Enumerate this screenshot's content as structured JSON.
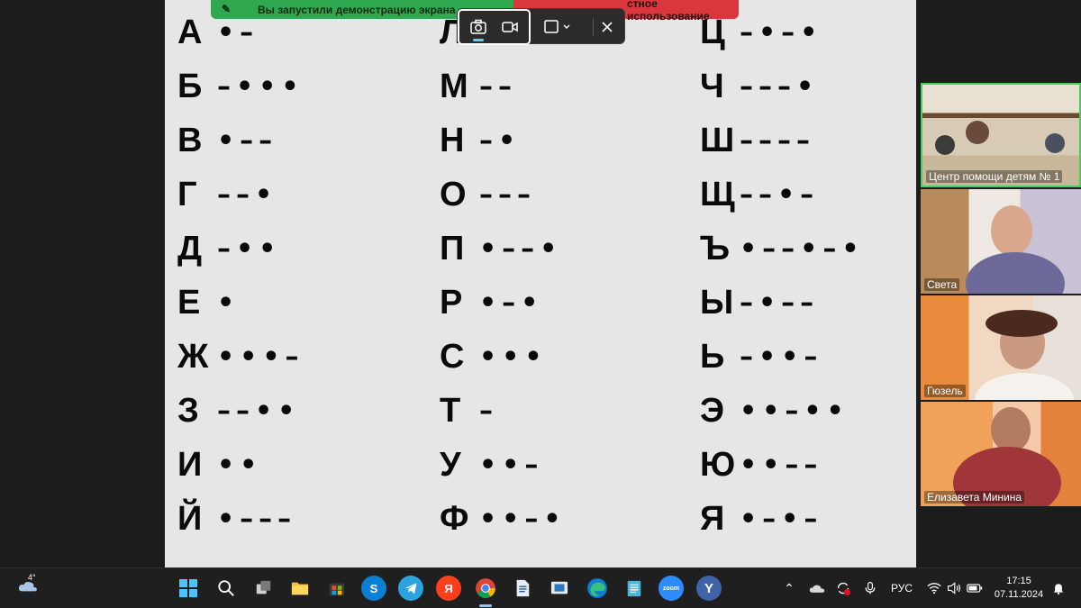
{
  "screen_share": {
    "green_banner_text": "Вы запустили демонстрацию экрана",
    "red_banner_text": "стное использование"
  },
  "morse": {
    "columns": [
      [
        {
          "letter": "А",
          "code": "•–"
        },
        {
          "letter": "Б",
          "code": "–•••"
        },
        {
          "letter": "В",
          "code": "•––"
        },
        {
          "letter": "Г",
          "code": "––•"
        },
        {
          "letter": "Д",
          "code": "–••"
        },
        {
          "letter": "Е",
          "code": "•"
        },
        {
          "letter": "Ж",
          "code": "•••–"
        },
        {
          "letter": "З",
          "code": "––••"
        },
        {
          "letter": "И",
          "code": "••"
        },
        {
          "letter": "Й",
          "code": "•–––"
        }
      ],
      [
        {
          "letter": "Л",
          "code": ""
        },
        {
          "letter": "М",
          "code": "––"
        },
        {
          "letter": "Н",
          "code": "–•"
        },
        {
          "letter": "О",
          "code": "–––"
        },
        {
          "letter": "П",
          "code": "•––•"
        },
        {
          "letter": "Р",
          "code": "•–•"
        },
        {
          "letter": "С",
          "code": "•••"
        },
        {
          "letter": "Т",
          "code": "–"
        },
        {
          "letter": "У",
          "code": "••–"
        },
        {
          "letter": "Ф",
          "code": "••–•"
        }
      ],
      [
        {
          "letter": "Ц",
          "code": "–•–•"
        },
        {
          "letter": "Ч",
          "code": "–––•"
        },
        {
          "letter": "Ш",
          "code": "––––"
        },
        {
          "letter": "Щ",
          "code": "––•–"
        },
        {
          "letter": "Ъ",
          "code": "•––•–•"
        },
        {
          "letter": "Ы",
          "code": "–•––"
        },
        {
          "letter": "Ь",
          "code": "–••–"
        },
        {
          "letter": "Э",
          "code": "••–••"
        },
        {
          "letter": "Ю",
          "code": "••––"
        },
        {
          "letter": "Я",
          "code": "•–•–"
        }
      ]
    ]
  },
  "snipping_toolbar": {
    "buttons": [
      "camera-icon",
      "video-icon",
      "snip-mode-icon",
      "close-icon"
    ]
  },
  "participants": [
    {
      "name": "Центр помощи детям № 1"
    },
    {
      "name": "Света"
    },
    {
      "name": "Гюзель"
    },
    {
      "name": "Елизавета Минина"
    }
  ],
  "taskbar": {
    "weather_temp": "4°",
    "language": "РУС",
    "time": "17:15",
    "date": "07.11.2024",
    "apps": [
      "start-icon",
      "search-icon",
      "task-view-icon",
      "file-explorer-icon",
      "store-icon",
      "skype-icon",
      "telegram-icon",
      "yandex-icon",
      "chrome-icon",
      "document-icon",
      "whiteboard-icon",
      "edge-icon",
      "notepad-icon",
      "zoom-icon",
      "yandex-browser-icon"
    ],
    "labels": {
      "skype": "S",
      "yandex": "Я",
      "zoom": "zoom",
      "yandex_browser": "Y"
    }
  },
  "colors": {
    "share_green": "#2fa84f",
    "share_red": "#d9363e",
    "active_speaker_border": "#3fd15a",
    "taskbar_bg": "#1f1f1f"
  }
}
